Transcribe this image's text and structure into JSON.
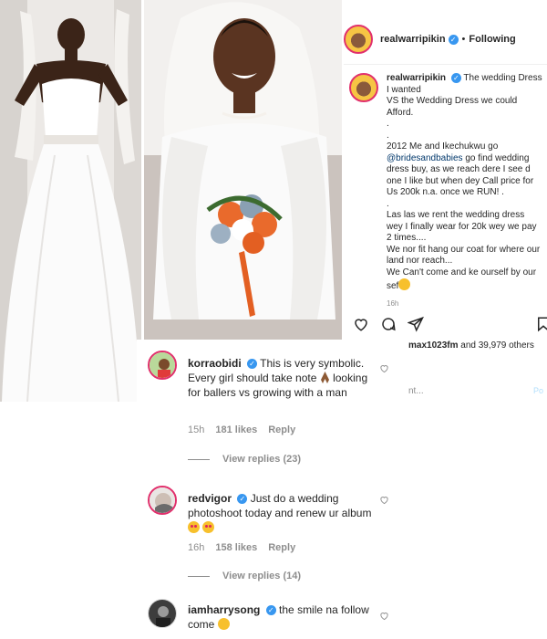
{
  "post": {
    "username": "realwarripikin",
    "follow_state": "Following",
    "separator": "•",
    "caption_user": "realwarripikin",
    "caption_line1": "The wedding Dress I wanted",
    "caption_line2": "VS the Wedding Dress we could Afford.",
    "caption_dot1": ".",
    "caption_dot2": ".",
    "caption_p1_before": "2012 Me and Ikechukwu go ",
    "caption_mention": "@bridesandbabies",
    "caption_p1_after": " go find wedding dress buy, as we reach dere I see d one I like but when dey Call price for Us 200k n.a. once we RUN! .",
    "caption_dot3": ".",
    "caption_p2": "Las las we rent the wedding dress wey I finally wear for 20k wey we pay 2 times....\nWe nor fit hang our coat for where our land nor reach...\nWe Can't come and ke ourself by our sef",
    "caption_time": "16h",
    "likes_user": "max1023fm",
    "likes_rest": " and 39,979 others",
    "add_comment_placeholder": "nt...",
    "post_button": "Po"
  },
  "comments": [
    {
      "username": "korraobidi",
      "text_before": "This is very symbolic. Every girl should take note ",
      "text_after": " looking for ballers vs growing with a man",
      "time": "15h",
      "likes": "181 likes",
      "reply": "Reply",
      "view_replies": "View replies (23)"
    },
    {
      "username": "redvigor",
      "text_before": "Just do a wedding photoshoot today and renew ur album ",
      "text_after": "",
      "time": "16h",
      "likes": "158 likes",
      "reply": "Reply",
      "view_replies": "View replies (14)"
    },
    {
      "username": "iamharrysong",
      "text_before": "the smile na follow come ",
      "text_after": ""
    }
  ],
  "icons": [
    "heart-icon",
    "comment-icon",
    "share-icon",
    "save-icon",
    "verified-badge-icon"
  ],
  "colors": {
    "verified": "#3897f0",
    "story_ring": "#e1306c",
    "muted": "#8e8e8e",
    "mention": "#00376b"
  }
}
